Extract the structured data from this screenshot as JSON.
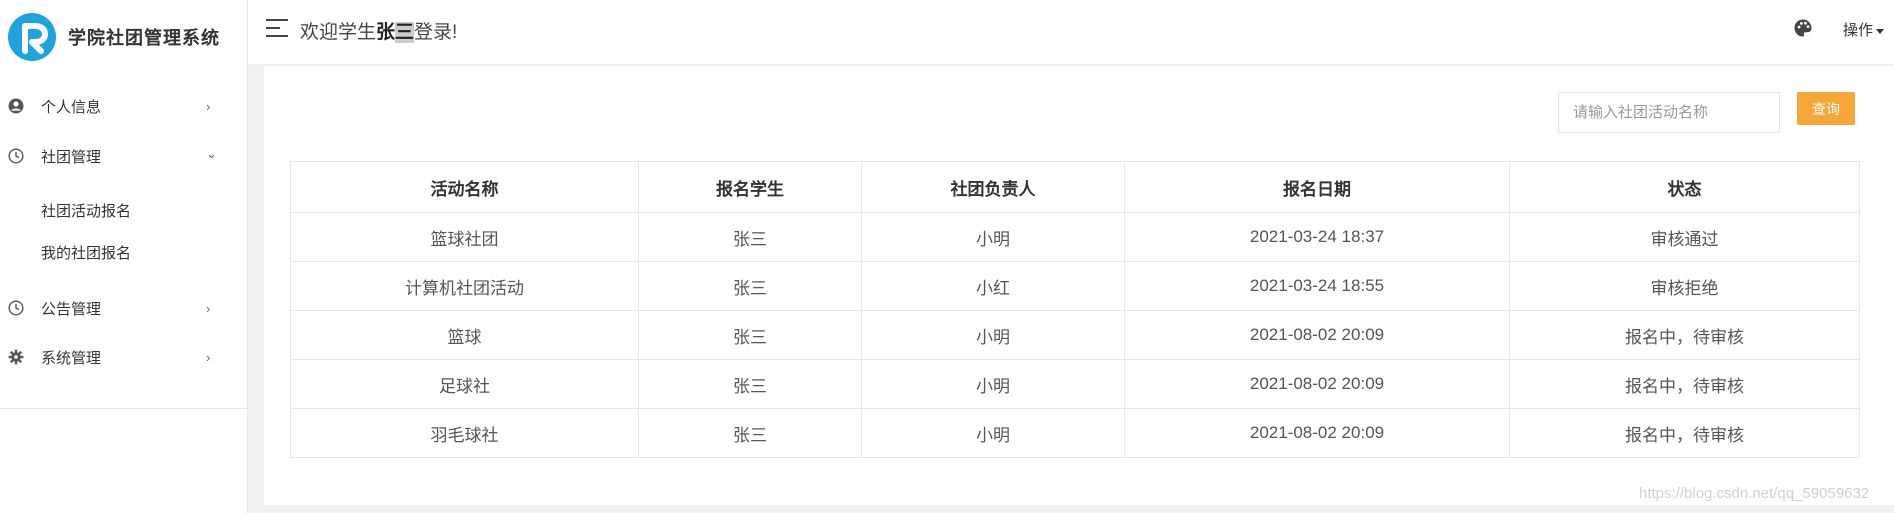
{
  "app": {
    "title": "学院社团管理系统"
  },
  "sidebar": {
    "items": [
      {
        "label": "个人信息",
        "icon": "user-circle-icon",
        "arrow": "›"
      },
      {
        "label": "社团管理",
        "icon": "clock-icon",
        "arrow": "⌄",
        "children": [
          {
            "label": "社团活动报名"
          },
          {
            "label": "我的社团报名"
          }
        ]
      },
      {
        "label": "公告管理",
        "icon": "clock-icon",
        "arrow": "›"
      },
      {
        "label": "系统管理",
        "icon": "gear-icon",
        "arrow": "›"
      }
    ]
  },
  "header": {
    "welcome_prefix": "欢迎学生",
    "user_name_1": "张",
    "user_name_2": "三",
    "welcome_suffix": "登录!",
    "ops_label": "操作"
  },
  "search": {
    "placeholder": "请输入社团活动名称",
    "value": "",
    "button_label": "查询"
  },
  "table": {
    "columns": [
      "活动名称",
      "报名学生",
      "社团负责人",
      "报名日期",
      "状态"
    ],
    "rows": [
      {
        "activity": "篮球社团",
        "student": "张三",
        "leader": "小明",
        "date": "2021-03-24 18:37",
        "status": "审核通过"
      },
      {
        "activity": "计算机社团活动",
        "student": "张三",
        "leader": "小红",
        "date": "2021-03-24 18:55",
        "status": "审核拒绝"
      },
      {
        "activity": "篮球",
        "student": "张三",
        "leader": "小明",
        "date": "2021-08-02 20:09",
        "status": "报名中，待审核"
      },
      {
        "activity": "足球社",
        "student": "张三",
        "leader": "小明",
        "date": "2021-08-02 20:09",
        "status": "报名中，待审核"
      },
      {
        "activity": "羽毛球社",
        "student": "张三",
        "leader": "小明",
        "date": "2021-08-02 20:09",
        "status": "报名中，待审核"
      }
    ]
  },
  "colors": {
    "accent": "#f7a63a",
    "logo": "#1fa3dc",
    "status_ok": "#9be23b",
    "status_rejected": "#ee0000"
  },
  "watermark": "https://blog.csdn.net/qq_59059632"
}
